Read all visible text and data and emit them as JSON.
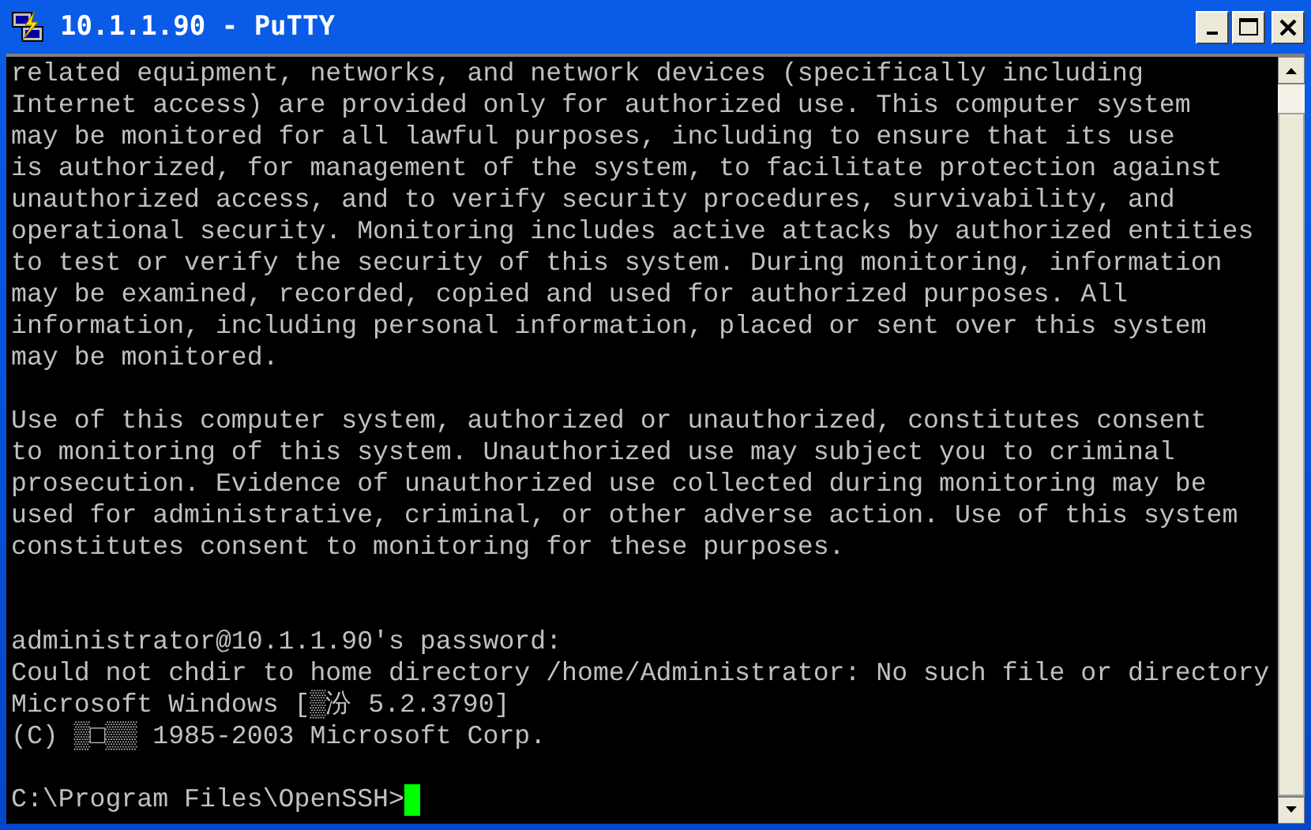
{
  "window": {
    "title": "10.1.1.90 - PuTTY"
  },
  "terminal": {
    "lines": [
      {
        "kind": "text",
        "text": "related equipment, networks, and network devices (specifically including"
      },
      {
        "kind": "text",
        "text": "Internet access) are provided only for authorized use. This computer system"
      },
      {
        "kind": "text",
        "text": "may be monitored for all lawful purposes, including to ensure that its use"
      },
      {
        "kind": "text",
        "text": "is authorized, for management of the system, to facilitate protection against"
      },
      {
        "kind": "text",
        "text": "unauthorized access, and to verify security procedures, survivability, and"
      },
      {
        "kind": "text",
        "text": "operational security. Monitoring includes active attacks by authorized entities"
      },
      {
        "kind": "text",
        "text": "to test or verify the security of this system. During monitoring, information"
      },
      {
        "kind": "text",
        "text": "may be examined, recorded, copied and used for authorized purposes. All"
      },
      {
        "kind": "text",
        "text": "information, including personal information, placed or sent over this system"
      },
      {
        "kind": "text",
        "text": "may be monitored."
      },
      {
        "kind": "blank"
      },
      {
        "kind": "text",
        "text": "Use of this computer system, authorized or unauthorized, constitutes consent"
      },
      {
        "kind": "text",
        "text": "to monitoring of this system. Unauthorized use may subject you to criminal"
      },
      {
        "kind": "text",
        "text": "prosecution. Evidence of unauthorized use collected during monitoring may be"
      },
      {
        "kind": "text",
        "text": "used for administrative, criminal, or other adverse action. Use of this system"
      },
      {
        "kind": "text",
        "text": "constitutes consent to monitoring for these purposes."
      },
      {
        "kind": "blank"
      },
      {
        "kind": "blank"
      },
      {
        "kind": "text",
        "text": "administrator@10.1.1.90's password:"
      },
      {
        "kind": "text",
        "text": "Could not chdir to home directory /home/Administrator: No such file or directory"
      },
      {
        "kind": "text",
        "text": "Microsoft Windows [▒汾 5.2.3790]"
      },
      {
        "kind": "text",
        "text": "(C) ▒□▒▒ 1985-2003 Microsoft Corp."
      },
      {
        "kind": "blank"
      },
      {
        "kind": "prompt",
        "text": "C:\\Program Files\\OpenSSH>"
      }
    ]
  }
}
